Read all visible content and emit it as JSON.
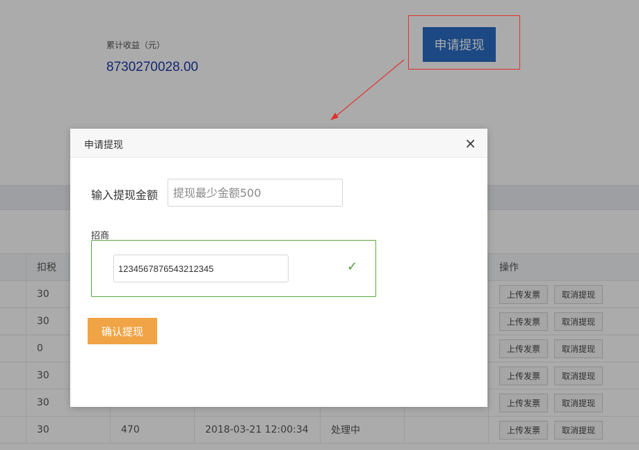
{
  "summary": {
    "earnings_label": "累计收益（元）",
    "earnings_value": "8730270028.00",
    "apply_button": "申请提现"
  },
  "table": {
    "headers": [
      "",
      "扣税",
      "",
      "",
      "",
      "",
      "操作"
    ],
    "rows": [
      {
        "tax": "30",
        "amount": "",
        "time": "",
        "status": ""
      },
      {
        "tax": "30",
        "amount": "",
        "time": "",
        "status": ""
      },
      {
        "tax": "0",
        "amount": "",
        "time": "",
        "status": ""
      },
      {
        "tax": "30",
        "amount": "",
        "time": "",
        "status": ""
      },
      {
        "tax": "30",
        "amount": "",
        "time": "",
        "status": ""
      },
      {
        "tax": "30",
        "amount": "470",
        "time": "2018-03-21 12:00:34",
        "status": "处理中"
      }
    ],
    "actions": {
      "upload": "上传发票",
      "cancel": "取消提现"
    }
  },
  "modal": {
    "title": "申请提现",
    "close_icon": "×",
    "amount_label": "输入提现金额",
    "amount_placeholder": "提现最少金额500",
    "amount_value": "",
    "bank_label": "招商",
    "card_number": "1234567876543212345",
    "valid_icon": "✓",
    "confirm_button": "确认提现"
  },
  "colors": {
    "apply_button": "#2b6cc4",
    "confirm_button": "#f0a445",
    "earnings_value": "#1e3aa8",
    "valid_border": "#57a83a",
    "annotation": "#e0322a"
  }
}
